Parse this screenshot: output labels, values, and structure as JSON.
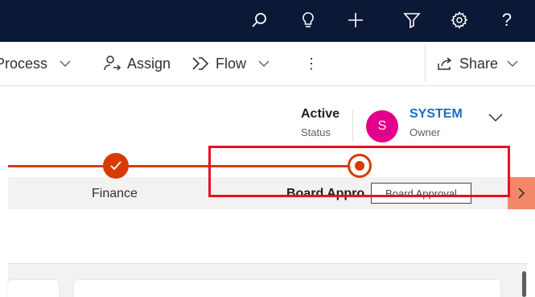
{
  "topbar": {
    "icons": [
      "search-icon",
      "lightbulb-icon",
      "plus-icon",
      "filter-icon",
      "gear-icon",
      "help-icon"
    ],
    "help_label": "?"
  },
  "commandbar": {
    "process_label": "Process",
    "assign_label": "Assign",
    "flow_label": "Flow",
    "more_label": "⋮",
    "share_label": "Share"
  },
  "header": {
    "status_value": "Active",
    "status_label": "Status",
    "owner_initial": "S",
    "owner_name": "SYSTEM",
    "owner_label": "Owner"
  },
  "process_bar": {
    "stages": [
      {
        "label": "Finance",
        "state": "completed"
      },
      {
        "label": "Board Appro",
        "state": "active"
      }
    ],
    "tooltip": "Board Approval"
  },
  "colors": {
    "topbar_bg": "#0c1936",
    "accent": "#d83b01",
    "avatar": "#e3008c",
    "link": "#1b6ec2",
    "highlight": "#e81123"
  }
}
